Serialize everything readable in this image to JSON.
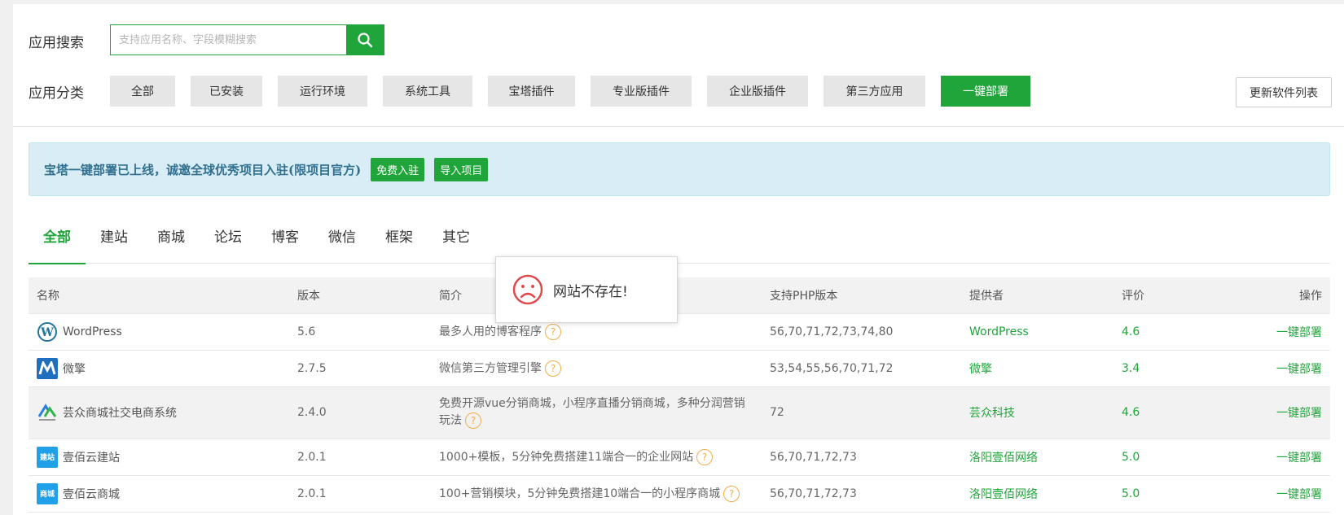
{
  "search": {
    "label": "应用搜索",
    "placeholder": "支持应用名称、字段模糊搜索",
    "value": ""
  },
  "category": {
    "label": "应用分类",
    "items": [
      {
        "label": "全部"
      },
      {
        "label": "已安装"
      },
      {
        "label": "运行环境"
      },
      {
        "label": "系统工具"
      },
      {
        "label": "宝塔插件"
      },
      {
        "label": "专业版插件"
      },
      {
        "label": "企业版插件"
      },
      {
        "label": "第三方应用"
      },
      {
        "label": "一键部署",
        "active": true
      }
    ],
    "update_button": "更新软件列表"
  },
  "notice": {
    "text": "宝塔一键部署已上线，诚邀全球优秀项目入驻(限项目官方)",
    "btn_join": "免费入驻",
    "btn_import": "导入项目"
  },
  "tabs": [
    "全部",
    "建站",
    "商城",
    "论坛",
    "博客",
    "微信",
    "框架",
    "其它"
  ],
  "table": {
    "headers": {
      "name": "名称",
      "version": "版本",
      "desc": "简介",
      "php": "支持PHP版本",
      "provider": "提供者",
      "rating": "评价",
      "action": "操作"
    },
    "rows": [
      {
        "name": "WordPress",
        "version": "5.6",
        "desc": "最多人用的博客程序",
        "php": "56,70,71,72,73,74,80",
        "provider": "WordPress",
        "rating": "4.6",
        "action": "一键部署"
      },
      {
        "name": "微擎",
        "version": "2.7.5",
        "desc": "微信第三方管理引擎",
        "php": "53,54,55,56,70,71,72",
        "provider": "微擎",
        "rating": "3.4",
        "action": "一键部署"
      },
      {
        "name": "芸众商城社交电商系统",
        "version": "2.4.0",
        "desc": "免费开源vue分销商城，小程序直播分销商城，多种分润营销玩法",
        "php": "72",
        "provider": "芸众科技",
        "rating": "4.6",
        "action": "一键部署"
      },
      {
        "name": "壹佰云建站",
        "version": "2.0.1",
        "desc": "1000+模板，5分钟免费搭建11端合一的企业网站",
        "php": "56,70,71,72,73",
        "provider": "洛阳壹佰网络",
        "rating": "5.0",
        "action": "一键部署"
      },
      {
        "name": "壹佰云商城",
        "version": "2.0.1",
        "desc": "100+营销模块，5分钟免费搭建10端合一的小程序商城",
        "php": "56,70,71,72,73",
        "provider": "洛阳壹佰网络",
        "rating": "5.0",
        "action": "一键部署"
      }
    ],
    "logos": {
      "r1": "wordpress-logo",
      "r2": "weiqing-logo",
      "r3": "yunzhong-logo",
      "r4": "jianzhan-logo",
      "r5": "shangcheng-logo"
    },
    "logo_text": {
      "jianzhan": "建站",
      "shangcheng": "商城"
    }
  },
  "popup": {
    "message": "网站不存在!",
    "icon": "sad-face-icon"
  },
  "colors": {
    "accent": "#20a53a",
    "notice_bg": "#d9edf7",
    "warn": "#f0ad4e",
    "error": "#e04a4a"
  }
}
